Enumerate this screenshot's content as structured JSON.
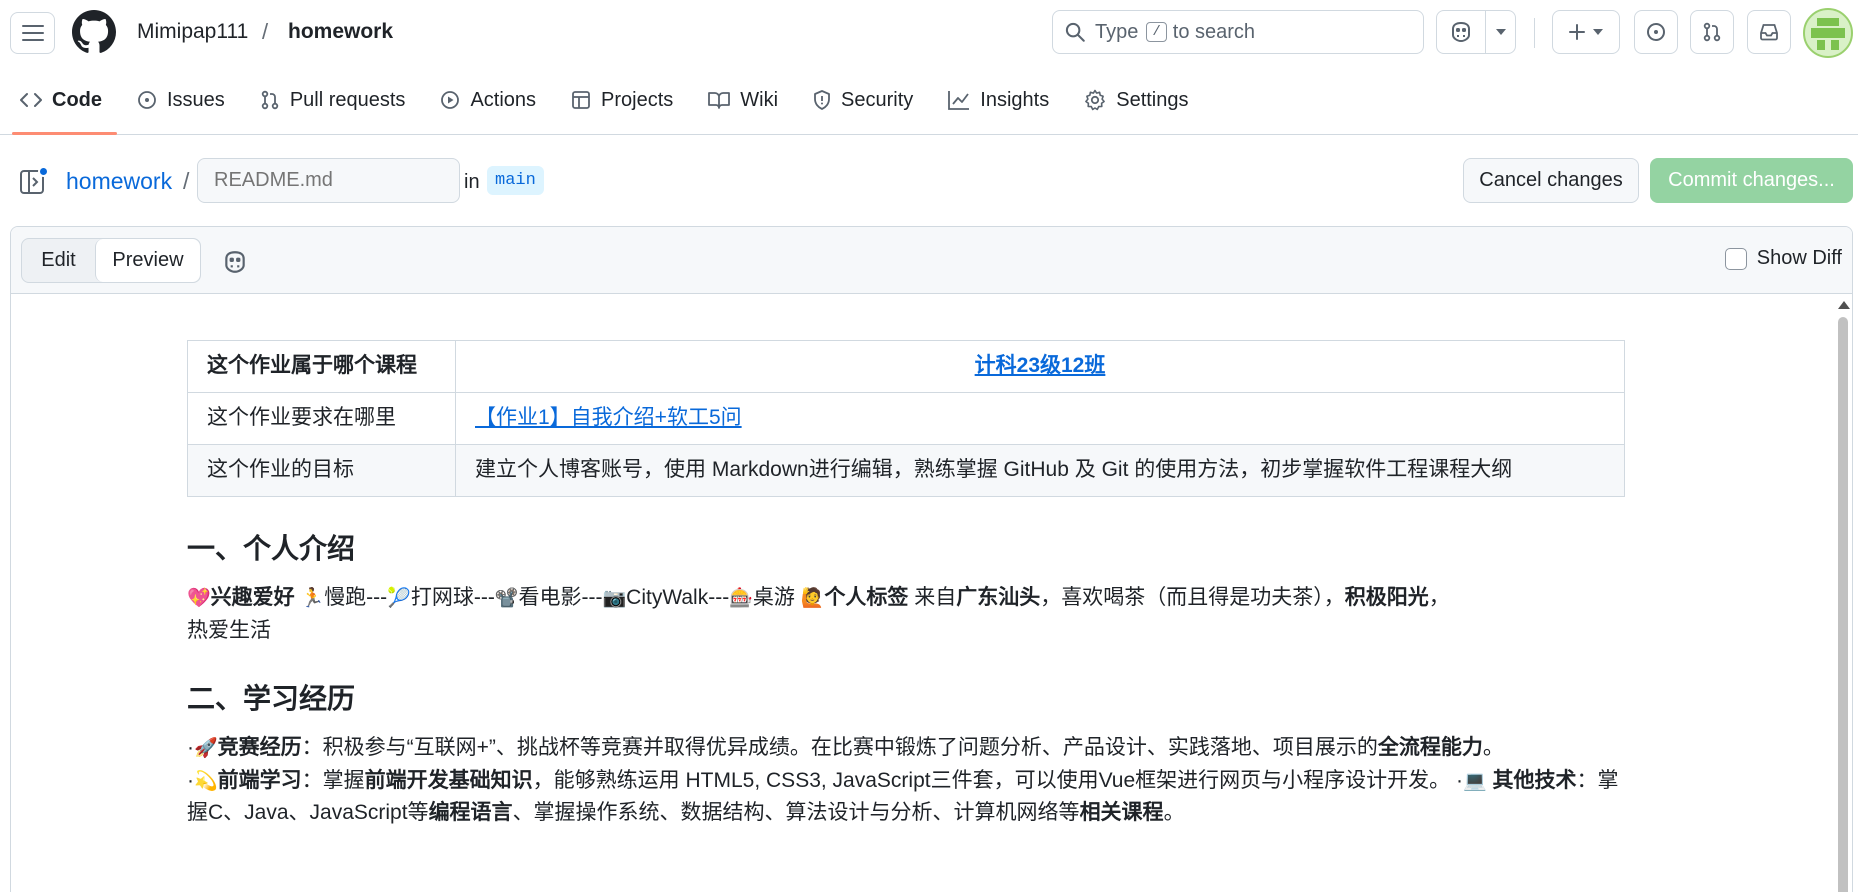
{
  "header": {
    "owner": "Mimipap111",
    "separator": "/",
    "repo": "homework",
    "search": {
      "prefix": "Type",
      "key": "/",
      "suffix": "to search"
    }
  },
  "nav": {
    "tabs": [
      {
        "label": "Code",
        "icon": "code-icon",
        "active": true
      },
      {
        "label": "Issues",
        "icon": "issue-icon"
      },
      {
        "label": "Pull requests",
        "icon": "pull-request-icon"
      },
      {
        "label": "Actions",
        "icon": "play-icon"
      },
      {
        "label": "Projects",
        "icon": "table-icon"
      },
      {
        "label": "Wiki",
        "icon": "book-icon"
      },
      {
        "label": "Security",
        "icon": "shield-icon"
      },
      {
        "label": "Insights",
        "icon": "graph-icon"
      },
      {
        "label": "Settings",
        "icon": "gear-icon"
      }
    ]
  },
  "editor": {
    "breadcrumb_repo": "homework",
    "breadcrumb_sep": "/",
    "filename_placeholder": "README.md",
    "in_label": "in",
    "branch": "main",
    "cancel_label": "Cancel changes",
    "commit_label": "Commit changes...",
    "tab_edit": "Edit",
    "tab_preview": "Preview",
    "show_diff": "Show Diff",
    "colors": {
      "commit_disabled": "#94d3a2",
      "link": "#0969da",
      "nav_active": "#fd8c73"
    }
  },
  "content": {
    "table": [
      {
        "key": "这个作业属于哪个课程",
        "value": "计科23级12班",
        "link": true
      },
      {
        "key": "这个作业要求在哪里",
        "value": "【作业1】自我介绍+软工5问",
        "link": true
      },
      {
        "key": "这个作业的目标",
        "value": "建立个人博客账号，使用 Markdown进行编辑，熟练掌握 GitHub 及 Git 的使用方法，初步掌握软件工程课程大纲",
        "link": false
      }
    ],
    "section1": {
      "title": "一、个人介绍",
      "emoji_heart": "💖",
      "hobby_label": "兴趣爱好",
      "emoji_run": "🏃",
      "run": "慢跑---",
      "emoji_tennis": "🎾",
      "tennis": "打网球---",
      "emoji_movie": "📽️",
      "movie": "看电影---",
      "emoji_camera": "📷",
      "citywalk": "CityWalk---",
      "emoji_game": "🎰",
      "boardgame": "桌游",
      "emoji_person": "🙋",
      "tag_label": "个人标签",
      "from": "来自",
      "hometown": "广东汕头",
      "tea": "，喜欢喝茶（而且得是功夫茶），",
      "positive": "积极阳光",
      "comma": "，",
      "love_life": "热爱生活"
    },
    "section2": {
      "title": "二、学习经历",
      "dot": "·",
      "emoji_rocket": "🚀",
      "comp_label": "竞赛经历",
      "comp_text": "：积极参与“互联网+”、挑战杯等竞赛并取得优异成绩。在比赛中锻炼了问题分析、产品设计、实践落地、项目展示的",
      "comp_bold": "全流程能力",
      "period": "。",
      "emoji_dizzy": "💫",
      "fe_label": "前端学习",
      "fe_text1": "：掌握",
      "fe_bold": "前端开发基础知识",
      "fe_text2": "，能够熟练运用 HTML5, CSS3, JavaScript三件套，可以使用Vue框架进行网页与小程序设计开发。",
      "emoji_laptop": "💻",
      "other_label": "其他技术",
      "other_text1": "：掌握C、Java、JavaScript等",
      "other_bold1": "编程语言",
      "other_text2": "、掌握操作系统、数据结构、算法设计与分析、计算机网络等",
      "other_bold2": "相关课程",
      "other_end": "。"
    }
  }
}
